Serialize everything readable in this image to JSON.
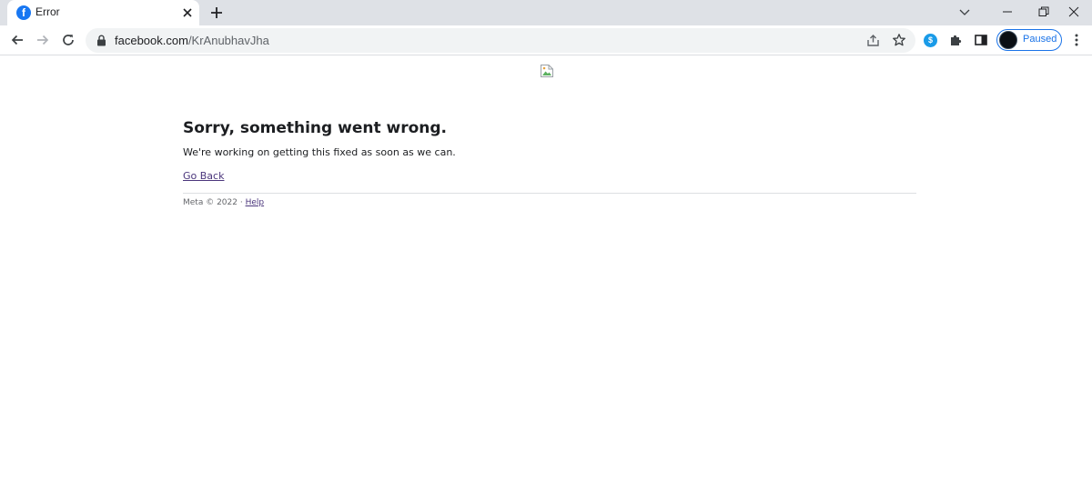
{
  "browser": {
    "tab": {
      "title": "Error",
      "favicon_icon": "facebook-icon",
      "favicon_glyph": "f"
    },
    "address_bar": {
      "url_host": "facebook.com",
      "url_path": "/KrAnubhavJha"
    },
    "profile": {
      "status_label": "Paused"
    },
    "extension_glyph": "$",
    "icons": [
      "back-arrow-icon",
      "forward-arrow-icon",
      "reload-icon",
      "lock-icon",
      "share-icon",
      "star-icon",
      "extensions-puzzle-icon",
      "side-panel-icon",
      "kebab-menu-icon",
      "tab-search-chevron-icon",
      "minimize-icon",
      "restore-icon",
      "close-icon",
      "new-tab-plus-icon"
    ],
    "accent_color": "#1a73e8",
    "tabstrip_color": "#dee1e6"
  },
  "page": {
    "heading": "Sorry, something went wrong.",
    "message": "We're working on getting this fixed as soon as we can.",
    "go_back_label": "Go Back",
    "footer": {
      "copyright": "Meta © 2022 · ",
      "help_label": "Help"
    },
    "link_color": "#4b367c"
  }
}
